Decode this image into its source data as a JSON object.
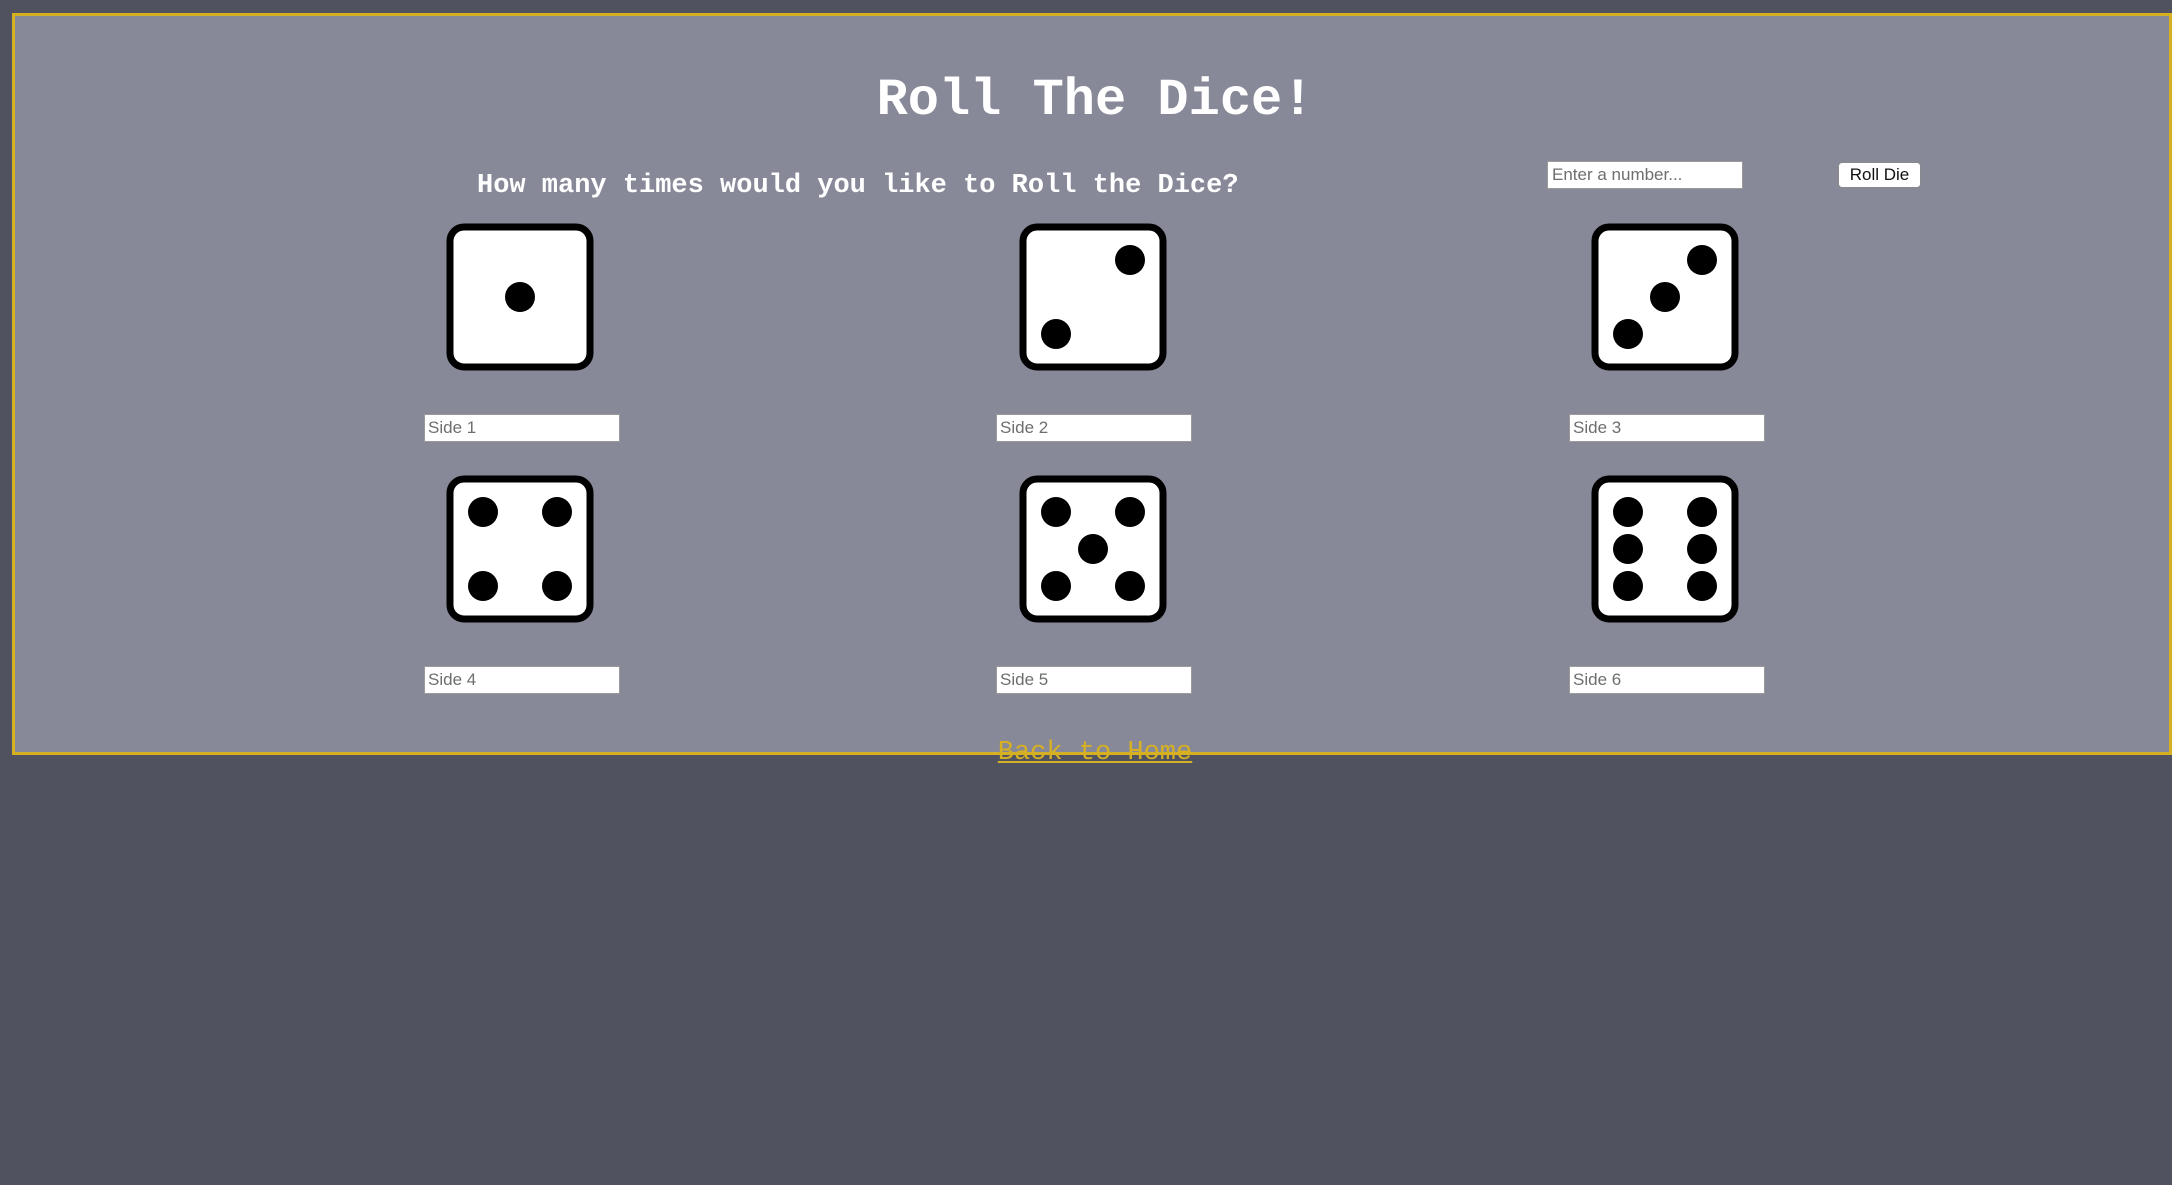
{
  "page": {
    "title": "Roll The Dice!",
    "question": "How many times would you like to Roll the Dice?",
    "roll_input": {
      "placeholder": "Enter a number...",
      "value": ""
    },
    "roll_button_label": "Roll Die",
    "home_link_label": "Back to Home"
  },
  "dice": [
    {
      "face": 1,
      "placeholder": "Side 1"
    },
    {
      "face": 2,
      "placeholder": "Side 2"
    },
    {
      "face": 3,
      "placeholder": "Side 3"
    },
    {
      "face": 4,
      "placeholder": "Side 4"
    },
    {
      "face": 5,
      "placeholder": "Side 5"
    },
    {
      "face": 6,
      "placeholder": "Side 6"
    }
  ],
  "colors": {
    "page_background": "#50525f",
    "panel_background": "#878898",
    "accent": "#d6b023",
    "heading_text": "#ffffff"
  }
}
